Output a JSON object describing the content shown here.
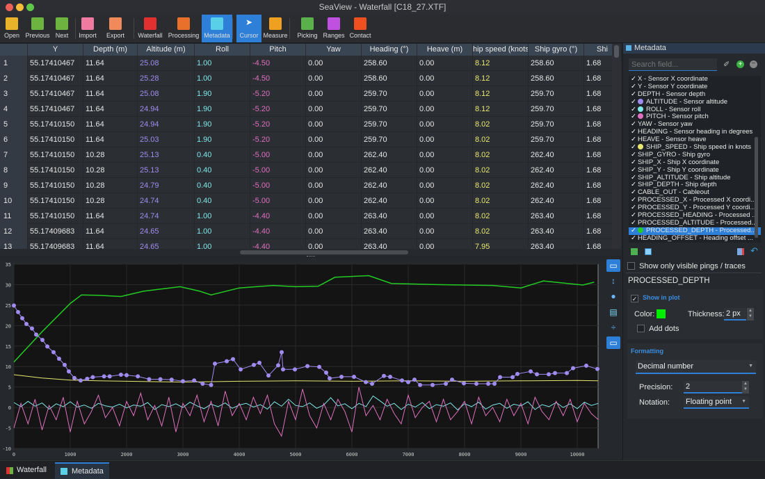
{
  "window": {
    "title": "SeaView - Waterfall [C18_27.XTF]"
  },
  "toolbar": [
    {
      "label": "Open",
      "icon": "folder-search-icon",
      "color": "#e8b32a"
    },
    {
      "label": "Previous",
      "icon": "previous-icon",
      "color": "#6cb33f"
    },
    {
      "label": "Next",
      "icon": "next-icon",
      "color": "#6cb33f"
    },
    {
      "label": "Import",
      "icon": "import-icon",
      "color": "#f07aa0"
    },
    {
      "label": "Export",
      "icon": "export-icon",
      "color": "#f08a5a"
    },
    {
      "label": "Waterfall",
      "icon": "waterfall-icon",
      "color": "#e23030"
    },
    {
      "label": "Processing",
      "icon": "gears-icon",
      "color": "#e8702a"
    },
    {
      "label": "Metadata",
      "icon": "table-icon",
      "color": "#5ad0e8"
    },
    {
      "label": "Cursor",
      "icon": "cursor-icon",
      "color": "#ffffff"
    },
    {
      "label": "Measure",
      "icon": "ruler-icon",
      "color": "#f0a020"
    },
    {
      "label": "Picking",
      "icon": "pencil-icon",
      "color": "#5ab04a"
    },
    {
      "label": "Ranges",
      "icon": "ranges-icon",
      "color": "#c050e0"
    },
    {
      "label": "Contact",
      "icon": "map-pin-icon",
      "color": "#f05020"
    }
  ],
  "table": {
    "columns": [
      "Y",
      "Depth (m)",
      "Altitude (m)",
      "Roll",
      "Pitch",
      "Yaw",
      "Heading (°)",
      "Heave (m)",
      "hip speed (knots",
      "Ship gyro (°)",
      "Shi"
    ],
    "rows": [
      [
        "1",
        "55.17410467",
        "11.64",
        "25.08",
        "1.00",
        "-4.50",
        "0.00",
        "258.60",
        "0.00",
        "8.12",
        "258.60",
        "1.68"
      ],
      [
        "2",
        "55.17410467",
        "11.64",
        "25.28",
        "1.00",
        "-4.50",
        "0.00",
        "258.60",
        "0.00",
        "8.12",
        "258.60",
        "1.68"
      ],
      [
        "3",
        "55.17410467",
        "11.64",
        "25.08",
        "1.90",
        "-5.20",
        "0.00",
        "259.70",
        "0.00",
        "8.12",
        "259.70",
        "1.68"
      ],
      [
        "4",
        "55.17410467",
        "11.64",
        "24.94",
        "1.90",
        "-5.20",
        "0.00",
        "259.70",
        "0.00",
        "8.12",
        "259.70",
        "1.68"
      ],
      [
        "5",
        "55.17410150",
        "11.64",
        "24.94",
        "1.90",
        "-5.20",
        "0.00",
        "259.70",
        "0.00",
        "8.02",
        "259.70",
        "1.68"
      ],
      [
        "6",
        "55.17410150",
        "11.64",
        "25.03",
        "1.90",
        "-5.20",
        "0.00",
        "259.70",
        "0.00",
        "8.02",
        "259.70",
        "1.68"
      ],
      [
        "7",
        "55.17410150",
        "10.28",
        "25.13",
        "0.40",
        "-5.00",
        "0.00",
        "262.40",
        "0.00",
        "8.02",
        "262.40",
        "1.68"
      ],
      [
        "8",
        "55.17410150",
        "10.28",
        "25.13",
        "0.40",
        "-5.00",
        "0.00",
        "262.40",
        "0.00",
        "8.02",
        "262.40",
        "1.68"
      ],
      [
        "9",
        "55.17410150",
        "10.28",
        "24.79",
        "0.40",
        "-5.00",
        "0.00",
        "262.40",
        "0.00",
        "8.02",
        "262.40",
        "1.68"
      ],
      [
        "10",
        "55.17410150",
        "10.28",
        "24.74",
        "0.40",
        "-5.00",
        "0.00",
        "262.40",
        "0.00",
        "8.02",
        "262.40",
        "1.68"
      ],
      [
        "11",
        "55.17410150",
        "11.64",
        "24.74",
        "1.00",
        "-4.40",
        "0.00",
        "263.40",
        "0.00",
        "8.02",
        "263.40",
        "1.68"
      ],
      [
        "12",
        "55.17409683",
        "11.64",
        "24.65",
        "1.00",
        "-4.40",
        "0.00",
        "263.40",
        "0.00",
        "8.02",
        "263.40",
        "1.68"
      ],
      [
        "13",
        "55.17409683",
        "11.64",
        "24.65",
        "1.00",
        "-4.40",
        "0.00",
        "263.40",
        "0.00",
        "7.95",
        "263.40",
        "1.68"
      ]
    ],
    "column_colors": {
      "3": "#a08cf0",
      "4": "#7fe8e8",
      "5": "#e070c0",
      "9": "#e8e870"
    }
  },
  "metadata_panel": {
    "title": "Metadata",
    "search_placeholder": "Search field...",
    "fields": [
      {
        "label": "X - Sensor X coordinate"
      },
      {
        "label": "Y - Sensor Y coordinate"
      },
      {
        "label": "DEPTH - Sensor depth"
      },
      {
        "label": "ALTITUDE - Sensor altitude",
        "color": "#a08cf0"
      },
      {
        "label": "ROLL - Sensor roll",
        "color": "#7fe8e8"
      },
      {
        "label": "PITCH - Sensor pitch",
        "color": "#e070c0"
      },
      {
        "label": "YAW - Sensor yaw"
      },
      {
        "label": "HEADING - Sensor heading in degrees"
      },
      {
        "label": "HEAVE - Sensor heave"
      },
      {
        "label": "SHIP_SPEED - Ship speed in knots",
        "color": "#e8e870"
      },
      {
        "label": "SHIP_GYRO - Ship gyro"
      },
      {
        "label": "SHIP_X - Ship X coordinate"
      },
      {
        "label": "SHIP_Y - Ship Y coordinate"
      },
      {
        "label": "SHIP_ALTITUDE - Ship altitude"
      },
      {
        "label": "SHIP_DEPTH - Ship depth"
      },
      {
        "label": "CABLE_OUT - Cableout"
      },
      {
        "label": "PROCESSED_X - Processed X coordi..."
      },
      {
        "label": "PROCESSED_Y - Processed Y coordi..."
      },
      {
        "label": "PROCESSED_HEADING - Processed ..."
      },
      {
        "label": "PROCESSED_ALTITUDE - Processed..."
      },
      {
        "label": "PROCESSED_DEPTH - Processed...",
        "color": "#22cc22",
        "selected": true
      },
      {
        "label": "HEADING_OFFSET - Heading offset ..."
      }
    ],
    "show_visible_label": "Show only visible pings / traces",
    "selected_field": "PROCESSED_DEPTH",
    "show_in_plot_label": "Show in plot",
    "show_in_plot": true,
    "color_label": "Color:",
    "color": "#00ee00",
    "thickness_label": "Thickness:",
    "thickness": "2 px",
    "add_dots_label": "Add dots",
    "add_dots": false,
    "formatting_label": "Formatting",
    "format": "Decimal number",
    "precision_label": "Precision:",
    "precision": "2",
    "notation_label": "Notation:",
    "notation": "Floating point"
  },
  "bottom_tabs": [
    {
      "label": "Waterfall",
      "active": false
    },
    {
      "label": "Metadata",
      "active": true
    }
  ],
  "chart_data": {
    "type": "line",
    "xlim": [
      0,
      10370
    ],
    "ylim": [
      -10,
      35
    ],
    "xticks": [
      "0",
      "1000",
      "2000",
      "3000",
      "4000",
      "5000",
      "6000",
      "7000",
      "8000",
      "9000",
      "10000"
    ],
    "yticks": [
      "-10",
      "-5",
      "0",
      "5",
      "10",
      "15",
      "20",
      "25",
      "30",
      "35"
    ],
    "grid": true,
    "series": [
      {
        "field": "PROCESSED_DEPTH",
        "color": "#22cc22",
        "dots": false,
        "x": [
          0,
          500,
          1000,
          1200,
          1500,
          1900,
          2300,
          2600,
          2950,
          3300,
          3500,
          4000,
          4600,
          5000,
          5400,
          5700,
          6300,
          6700,
          7500,
          8500,
          9000,
          9400,
          10100,
          10300
        ],
        "y": [
          11.1,
          18.5,
          25.4,
          27.5,
          27.4,
          27.1,
          28.4,
          28.9,
          29.5,
          28.4,
          27.5,
          29.2,
          29.8,
          29.5,
          29.6,
          31.8,
          32.2,
          30.3,
          30.0,
          29.8,
          29.2,
          30.9,
          29.9,
          30.6
        ]
      },
      {
        "field": "SHIP_SPEED",
        "color": "#e8e870",
        "dots": false,
        "x": [
          0,
          500,
          1000,
          1500,
          2000,
          3000,
          4000,
          5000,
          6000,
          7000,
          8000,
          9000,
          10000,
          10370
        ],
        "y": [
          8.0,
          7.2,
          6.7,
          6.5,
          6.4,
          6.2,
          6.4,
          6.5,
          6.4,
          6.5,
          6.4,
          6.5,
          6.6,
          6.5
        ]
      },
      {
        "field": "ALTITUDE",
        "color": "#a08cf0",
        "dots": true,
        "x": [
          0,
          74,
          148,
          222,
          321,
          395,
          506,
          593,
          704,
          802,
          901,
          975,
          1074,
          1185,
          1300,
          1400,
          1600,
          1700,
          1900,
          2000,
          2200,
          2400,
          2600,
          2800,
          3000,
          3200,
          3350,
          3500,
          3568,
          3778,
          3889,
          4025,
          4259,
          4358,
          4519,
          4691,
          4753,
          4778,
          4988,
          5210,
          5420,
          5543,
          5605,
          5815,
          6037,
          6247,
          6358,
          6568,
          6679,
          6889,
          7000,
          7111,
          7210,
          7432,
          7667,
          7778,
          7988,
          8210,
          8420,
          8531,
          8630,
          8852,
          8938,
          9173,
          9284,
          9494,
          9605,
          9815,
          9926,
          10160,
          10358
        ],
        "y": [
          24.9,
          23.3,
          21.8,
          20.4,
          19.3,
          17.8,
          16.5,
          14.9,
          13.5,
          11.9,
          10.4,
          8.8,
          7.2,
          6.6,
          7.0,
          7.4,
          7.6,
          7.6,
          8.0,
          7.9,
          7.6,
          6.9,
          6.9,
          6.8,
          6.4,
          6.6,
          5.8,
          5.5,
          10.7,
          11.3,
          11.8,
          9.3,
          10.4,
          10.9,
          7.8,
          10.3,
          13.5,
          9.3,
          9.3,
          10.1,
          9.9,
          8.5,
          7.1,
          7.5,
          7.5,
          6.2,
          5.8,
          7.7,
          7.5,
          6.6,
          6.2,
          6.8,
          5.5,
          5.5,
          5.8,
          6.8,
          5.9,
          5.8,
          5.8,
          5.8,
          7.4,
          7.4,
          8.2,
          8.8,
          8.1,
          8.1,
          8.4,
          8.4,
          9.6,
          10.2,
          9.4
        ]
      },
      {
        "field": "ROLL",
        "color": "#7fe8e8",
        "dots": false,
        "x_step": 125,
        "y": [
          1.2,
          0.2,
          1.5,
          0.3,
          1.1,
          -0.4,
          0.9,
          0.2,
          1.4,
          0.1,
          0.6,
          -0.2,
          1.0,
          0.4,
          0.1,
          0.8,
          -0.1,
          0.6,
          0.3,
          1.2,
          -0.5,
          0.7,
          0.2,
          0.9,
          0.0,
          1.3,
          0.4,
          -0.3,
          0.8,
          0.2,
          1.1,
          -0.2,
          0.6,
          1.0,
          0.1,
          0.7,
          -0.4,
          1.4,
          0.3,
          2.0,
          0.5,
          0.2,
          1.1,
          -0.2,
          0.6,
          2.4,
          0.4,
          0.9,
          -0.3,
          1.0,
          0.2,
          2.8,
          1.6,
          0.3,
          1.0,
          -0.5,
          0.8,
          0.1,
          1.2,
          -0.3,
          0.7,
          0.3,
          1.1,
          -0.6,
          0.9,
          0.2,
          1.3,
          -0.4,
          0.6,
          1.0,
          -0.2,
          0.8,
          0.4,
          1.4,
          -0.5,
          0.7,
          0.2,
          1.2,
          0.0,
          0.9,
          -0.3,
          1.3,
          0.5,
          1.0
        ]
      },
      {
        "field": "PITCH",
        "color": "#e070c0",
        "dots": false,
        "x_step": 125,
        "y": [
          -5,
          1,
          -4,
          2,
          -5.5,
          0.5,
          -3,
          2.5,
          -6,
          1.5,
          -4,
          -1,
          3,
          -2.5,
          0,
          -4.5,
          1.5,
          -2,
          3.5,
          -3,
          0.5,
          -4.5,
          2.5,
          -6,
          1,
          -2,
          3,
          -3.5,
          1.5,
          -4.5,
          4,
          -2,
          1,
          -3,
          2.5,
          -1.5,
          3,
          -4,
          -7,
          1.5,
          -3,
          4.5,
          -2,
          -5,
          1,
          -3,
          2,
          -1,
          -6,
          5,
          -2,
          0.5,
          -3,
          2,
          -1.5,
          -4,
          3,
          -2.5,
          0,
          1.5,
          -3.5,
          2,
          -3,
          -1,
          1.5,
          -4,
          2.5,
          -2,
          0,
          -3.5,
          2,
          -2,
          1,
          -4,
          2.5,
          -1,
          -3,
          1.5,
          -2,
          2,
          -3.5,
          1,
          -1.5,
          -3
        ]
      }
    ]
  }
}
